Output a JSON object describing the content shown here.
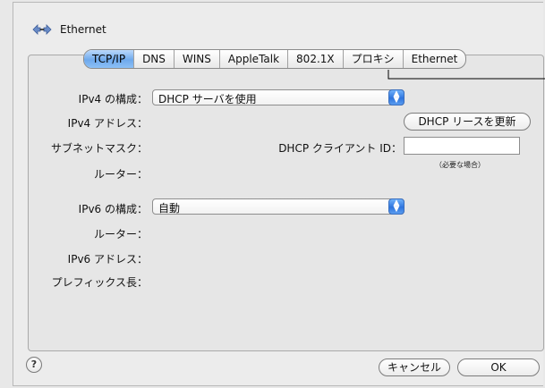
{
  "window": {
    "title": "Ethernet"
  },
  "tabs": [
    {
      "label": "TCP/IP",
      "active": true
    },
    {
      "label": "DNS",
      "active": false
    },
    {
      "label": "WINS",
      "active": false
    },
    {
      "label": "AppleTalk",
      "active": false
    },
    {
      "label": "802.1X",
      "active": false
    },
    {
      "label": "プロキシ",
      "active": false
    },
    {
      "label": "Ethernet",
      "active": false
    }
  ],
  "ipv4": {
    "config_label": "IPv4 の構成：",
    "config_value": "DHCP サーバを使用",
    "address_label": "IPv4 アドレス：",
    "dhcp_renew_button": "DHCP リースを更新",
    "subnet_label": "サブネットマスク：",
    "client_id_label": "DHCP クライアント ID：",
    "client_id_value": "",
    "client_id_note": "（必要な場合）",
    "router_label": "ルーター："
  },
  "ipv6": {
    "config_label": "IPv6 の構成：",
    "config_value": "自動",
    "router_label": "ルーター：",
    "address_label": "IPv6 アドレス：",
    "prefix_label": "プレフィックス長："
  },
  "footer": {
    "help_symbol": "?",
    "cancel_button": "キャンセル",
    "ok_button": "OK"
  },
  "icons": {
    "ethernet": "ethernet-icon",
    "popup_arrows": "popup-arrows-icon",
    "help": "help-icon"
  }
}
